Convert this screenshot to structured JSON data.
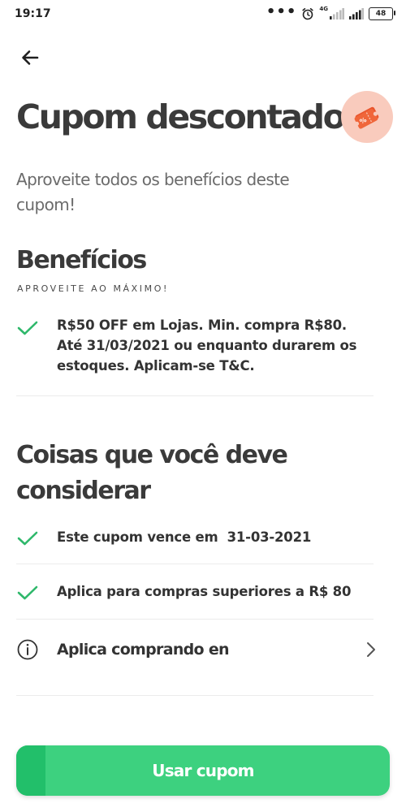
{
  "status_bar": {
    "time": "19:17",
    "network": "4G",
    "battery": "48"
  },
  "header": {
    "title": "Cupom descontado!",
    "subtitle": "Aproveite todos os benefícios deste cupom!"
  },
  "benefits": {
    "title": "Benefícios",
    "eyebrow": "APROVEITE AO MÁXIMO!",
    "items": [
      "R$50 OFF em Lojas. Min. compra R$80. Até 31/03/2021 ou enquanto durarem os estoques. Aplicam-se T&C."
    ]
  },
  "considerations": {
    "title": "Coisas que você deve considerar",
    "items": [
      "Este cupom vence em  31-03-2021",
      "Aplica para compras superiores a R$ 80"
    ],
    "link_label": "Aplica comprando en"
  },
  "cta": {
    "label": "Usar cupom"
  },
  "icons": {
    "back": "arrow-left-icon",
    "check": "check-icon",
    "info": "info-icon",
    "chevron": "chevron-right-icon",
    "coupon": "coupon-ticket-icon"
  },
  "colors": {
    "accent": "#3dd17f",
    "accent_dark": "#22bf6a",
    "check": "#2fb86b",
    "avatar_bg": "#f9cbbd",
    "ticket": "#f0663a"
  }
}
